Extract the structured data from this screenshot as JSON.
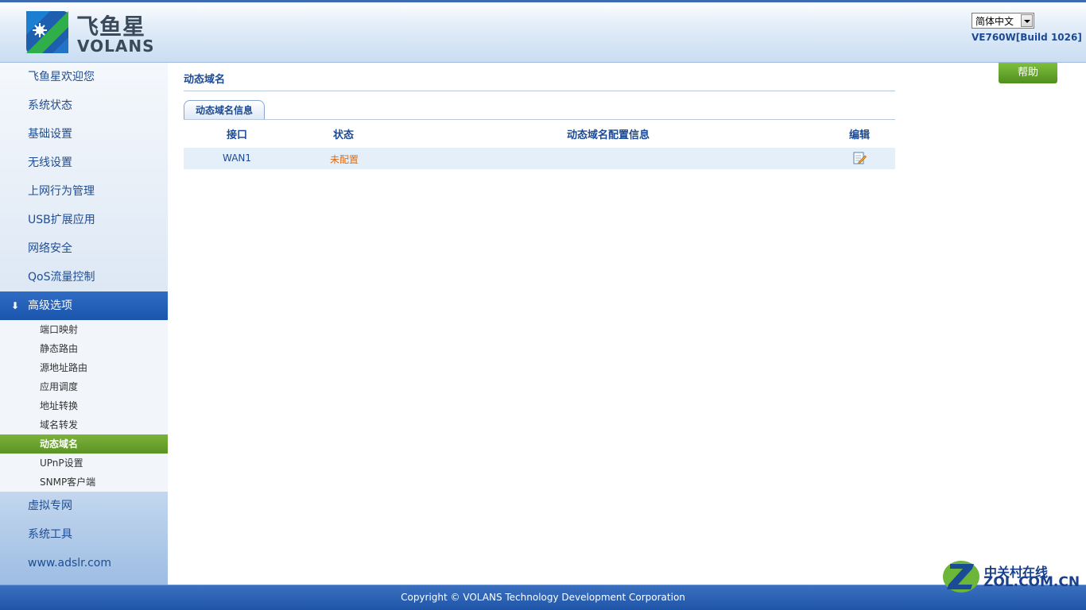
{
  "header": {
    "logo_cn": "飞鱼星",
    "logo_en": "VOLANS",
    "language": "简体中文",
    "version": "VE760W[Build 1026]"
  },
  "sidebar": {
    "top_items": [
      {
        "label": "飞鱼星欢迎您"
      },
      {
        "label": "系统状态"
      },
      {
        "label": "基础设置"
      },
      {
        "label": "无线设置"
      },
      {
        "label": "上网行为管理"
      },
      {
        "label": "USB扩展应用"
      },
      {
        "label": "网络安全"
      },
      {
        "label": "QoS流量控制"
      }
    ],
    "active_section": "高级选项",
    "sub_items": [
      {
        "label": "端口映射"
      },
      {
        "label": "静态路由"
      },
      {
        "label": "源地址路由"
      },
      {
        "label": "应用调度"
      },
      {
        "label": "地址转换"
      },
      {
        "label": "域名转发"
      },
      {
        "label": "动态域名"
      },
      {
        "label": "UPnP设置"
      },
      {
        "label": "SNMP客户端"
      }
    ],
    "bottom_items": [
      {
        "label": "虚拟专网"
      },
      {
        "label": "系统工具"
      },
      {
        "label": "www.adslr.com"
      }
    ]
  },
  "main": {
    "page_title": "动态域名",
    "help_label": "帮助",
    "tab_label": "动态域名信息",
    "columns": [
      "接口",
      "状态",
      "动态域名配置信息",
      "编辑"
    ],
    "rows": [
      {
        "interface": "WAN1",
        "status": "未配置",
        "config_info": "",
        "edit_icon": "edit-icon"
      }
    ]
  },
  "footer": {
    "copyright": "Copyright © VOLANS Technology Development Corporation"
  },
  "watermark": {
    "cn": "中关村在线",
    "en": "ZOL.COM.CN"
  },
  "colors": {
    "brand_blue": "#1c4a94",
    "active_nav": "#1b56ad",
    "active_sub": "#5b9424",
    "status_orange": "#e06b0e"
  }
}
